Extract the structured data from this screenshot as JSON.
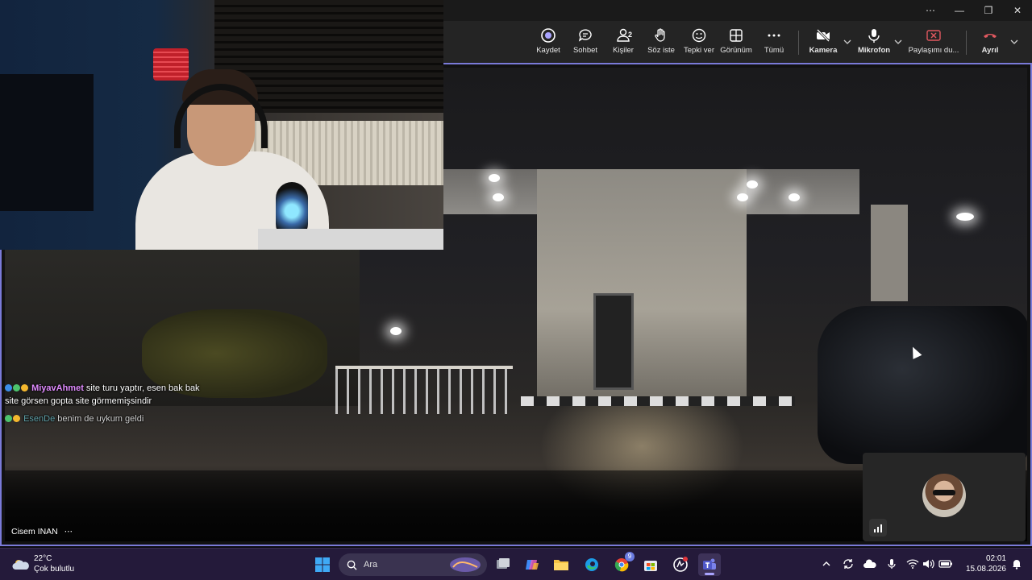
{
  "window": {
    "controls": [
      "⋯",
      "—",
      "❐",
      "✕"
    ]
  },
  "toolbar": {
    "record": "Kaydet",
    "chat": "Sohbet",
    "people": "Kişiler",
    "people_count": "2",
    "raise_hand": "Söz iste",
    "react": "Tepki ver",
    "view": "Görünüm",
    "more": "Tümü",
    "camera": "Kamera",
    "mic": "Mikrofon",
    "share": "Paylaşımı du...",
    "leave": "Ayrıl",
    "colors": {
      "leave": "#e0585f",
      "share": "#e0585f",
      "accent": "#7a7ad8"
    }
  },
  "stage": {
    "participant_name": "Cisem INAN",
    "more_glyph": "⋯"
  },
  "chat": [
    {
      "user": "MiyavAhmet",
      "text": "site turu yaptır, esen bak bak site görsen gopta site görmemişsindir"
    },
    {
      "user": "EsenDe",
      "text": "benim de uykum geldi"
    }
  ],
  "taskbar": {
    "temperature": "22°C",
    "weather_text": "Çok bulutlu",
    "search_placeholder": "Ara",
    "time": "02:01",
    "date": "15.08.2026",
    "chrome_badge": "9"
  }
}
